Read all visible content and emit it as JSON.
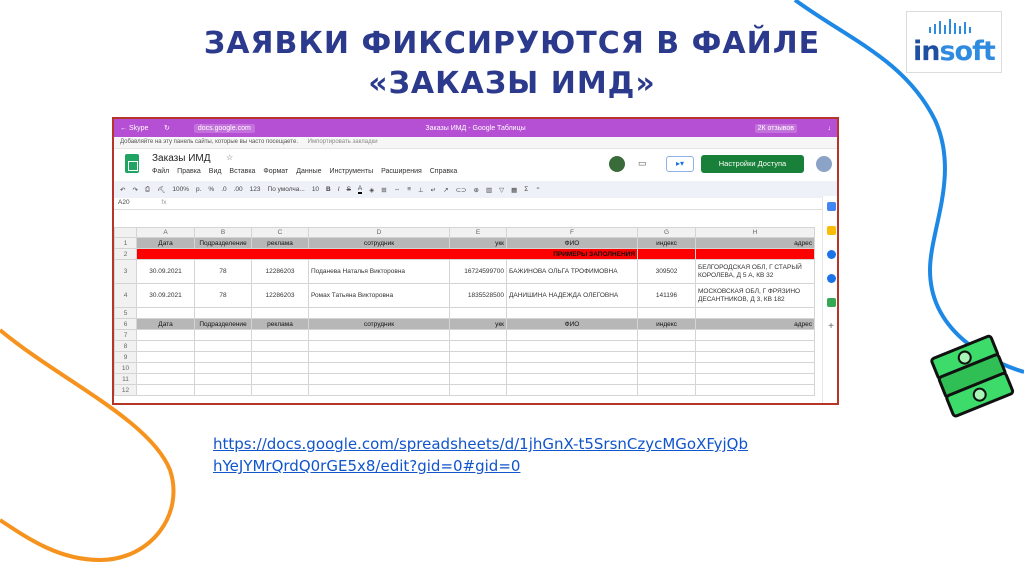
{
  "slide": {
    "title_line1": "ЗАЯВКИ ФИКСИРУЮТСЯ В ФАЙЛЕ",
    "title_line2": "«ЗАКАЗЫ ИМД»",
    "link": "https://docs.google.com/spreadsheets/d/1jhGnX-t5SrsnCzycMGoXFyjQbhYeJYMrQrdQ0rGE5x8/edit?gid=0#gid=0"
  },
  "logo": {
    "i": "in",
    "soft": "soft"
  },
  "browser": {
    "back_label": "← Skype",
    "url": "docs.google.com",
    "window_title": "Заказы ИМД - Google Таблицы",
    "reviews": "2К отзывов",
    "download_icon": "↓",
    "bookmarks_hint": "Добавляйте на эту панель сайты, которые вы часто посещаете.",
    "bookmarks_import": "Импортировать закладки"
  },
  "doc": {
    "name": "Заказы ИМД",
    "menus": [
      "Файл",
      "Правка",
      "Вид",
      "Вставка",
      "Формат",
      "Данные",
      "Инструменты",
      "Расширения",
      "Справка"
    ],
    "share_label": "Настройки Доступа"
  },
  "toolbar": {
    "zoom": "100%",
    "format_p": "р.",
    "format_pct": "%",
    "dec_less": ".0",
    "dec_more": ".00",
    "more_formats": "123",
    "font": "По умолча...",
    "font_size": "10",
    "bold": "B",
    "italic": "I",
    "strike": "S",
    "color": "A"
  },
  "formula_bar": {
    "cell": "A20",
    "fx": "fx"
  },
  "sheet": {
    "columns": [
      "A",
      "B",
      "C",
      "D",
      "E",
      "F",
      "G",
      "H"
    ],
    "header_row": [
      "Дата",
      "Подразделение",
      "реклама",
      "сотрудник",
      "укк",
      "ФИО",
      "индекс",
      "адрес"
    ],
    "examples_label": "ПРИМЕРЫ ЗАПОЛНЕНИЯ",
    "rows": [
      [
        "30.09.2021",
        "78",
        "12286203",
        "Поданева Наталья Викторовна",
        "16724599700",
        "БАЖИНОВА ОЛЬГА ТРОФИМОВНА",
        "309502",
        "БЕЛГОРОДСКАЯ ОБЛ, Г СТАРЫЙ КОРОЛЕВА, Д 5 А, КВ 32"
      ],
      [
        "30.09.2021",
        "78",
        "12286203",
        "Ромах Татьяна Викторовна",
        "1835528500",
        "ДАНИШИНА НАДЕЖДА ОЛЕГОВНА",
        "141196",
        "МОСКОВСКАЯ ОБЛ, Г ФРЯЗИНО ДЕСАНТНИКОВ, Д 3, КВ 182"
      ]
    ],
    "row_numbers": [
      "1",
      "2",
      "3",
      "4",
      "5",
      "6",
      "7",
      "8",
      "9",
      "10",
      "11",
      "12"
    ]
  },
  "colors": {
    "title": "#2b3a8c",
    "accent_blue": "#1e88e5",
    "accent_orange": "#f5931e",
    "browser_bar": "#b54fd3",
    "frame": "#b5352a",
    "share": "#188038"
  }
}
